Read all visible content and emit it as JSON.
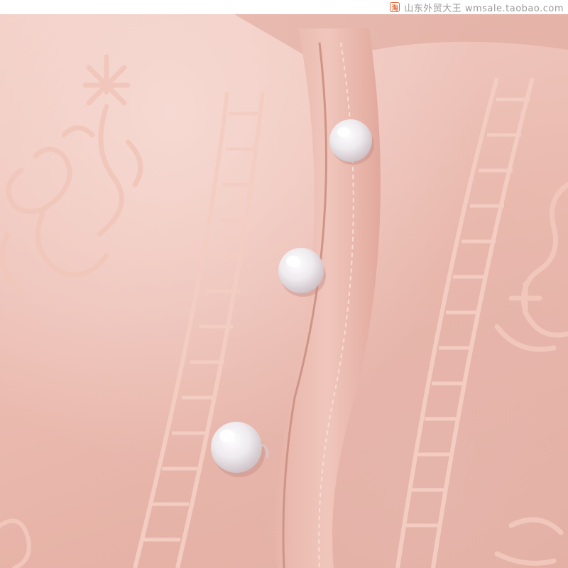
{
  "watermark": {
    "icon": "taobao-shop-icon",
    "icon_glyph": "淘",
    "text": "山东外贸大王  wmsale.taobao.com"
  },
  "colors": {
    "fabric": "#eab9ae",
    "fabric_light": "#f6d9d2",
    "embroidery": "#f0c9bd",
    "pearl": "#f4f2f4"
  },
  "buttons": {
    "count": 3
  }
}
